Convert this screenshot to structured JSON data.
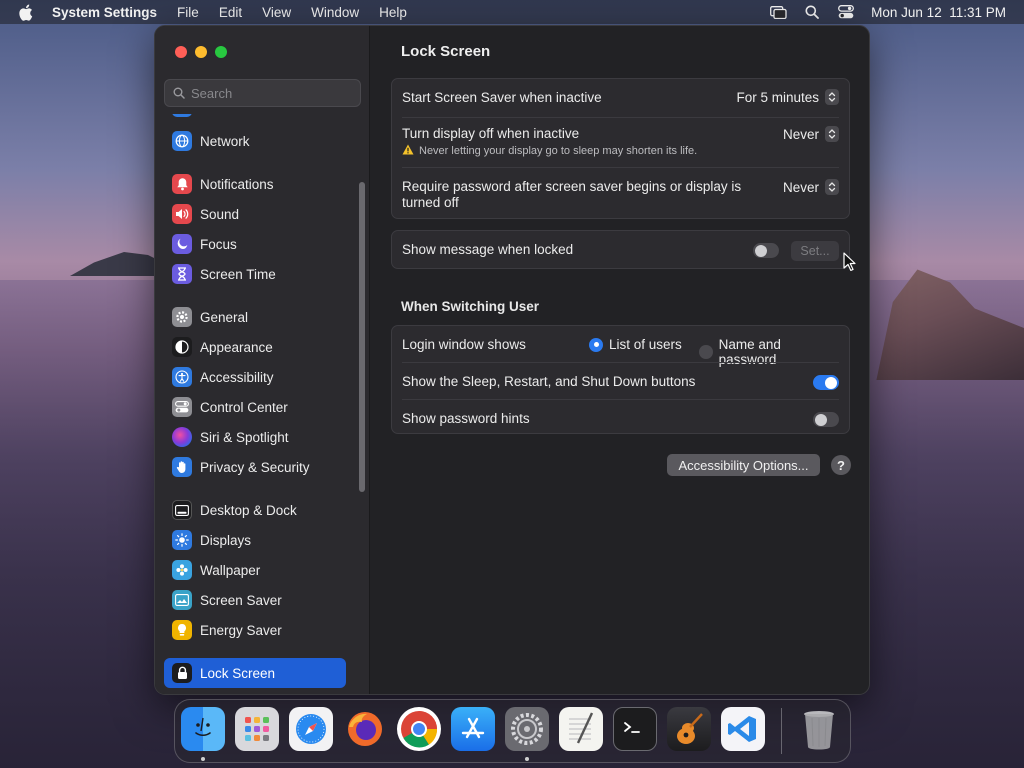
{
  "menubar": {
    "app_name": "System Settings",
    "menus": [
      "File",
      "Edit",
      "View",
      "Window",
      "Help"
    ],
    "clock": "Mon Jun 12  11:31 PM",
    "icons": [
      "screen-mirroring-icon",
      "spotlight-search-icon",
      "control-center-icon"
    ]
  },
  "search": {
    "placeholder": "Search"
  },
  "sidebar": {
    "items": [
      {
        "label": "Network",
        "icon": "globe-icon",
        "color": "#2f7ae0"
      },
      {
        "label": "Notifications",
        "icon": "bell-icon",
        "color": "#e5484d"
      },
      {
        "label": "Sound",
        "icon": "speaker-icon",
        "color": "#e5484d"
      },
      {
        "label": "Focus",
        "icon": "moon-icon",
        "color": "#6b5ce0"
      },
      {
        "label": "Screen Time",
        "icon": "hourglass-icon",
        "color": "#6b5ce0"
      },
      {
        "label": "General",
        "icon": "gear-icon",
        "color": "#8e8e93"
      },
      {
        "label": "Appearance",
        "icon": "appearance-icon",
        "color": "#1c1c1e"
      },
      {
        "label": "Accessibility",
        "icon": "accessibility-icon",
        "color": "#2f7ae0"
      },
      {
        "label": "Control Center",
        "icon": "control-center-icon",
        "color": "#8e8e93"
      },
      {
        "label": "Siri & Spotlight",
        "icon": "siri-icon",
        "color": "#a04ad8"
      },
      {
        "label": "Privacy & Security",
        "icon": "hand-icon",
        "color": "#2f7ae0"
      },
      {
        "label": "Desktop & Dock",
        "icon": "dock-icon",
        "color": "#1c1c1e"
      },
      {
        "label": "Displays",
        "icon": "sun-icon",
        "color": "#2f7ae0"
      },
      {
        "label": "Wallpaper",
        "icon": "wallpaper-icon",
        "color": "#3aa3e0"
      },
      {
        "label": "Screen Saver",
        "icon": "screen-saver-icon",
        "color": "#3aa3c8"
      },
      {
        "label": "Energy Saver",
        "icon": "bulb-icon",
        "color": "#f0b400"
      },
      {
        "label": "Lock Screen",
        "icon": "lock-icon",
        "color": "#1c1c1e",
        "selected": true
      }
    ]
  },
  "content": {
    "title": "Lock Screen",
    "screen_saver": {
      "label": "Start Screen Saver when inactive",
      "value": "For 5 minutes"
    },
    "display_off": {
      "label": "Turn display off when inactive",
      "value": "Never",
      "warning": "Never letting your display go to sleep may shorten its life."
    },
    "require_password": {
      "label_line1": "Require password after screen saver begins or display is",
      "label_line2": "turned off",
      "value": "Never"
    },
    "show_message": {
      "label": "Show message when locked",
      "enabled": false,
      "button": "Set..."
    },
    "switching_title": "When Switching User",
    "login_window": {
      "label": "Login window shows",
      "option1": "List of users",
      "option2": "Name and password",
      "selected": "List of users"
    },
    "sleep_buttons": {
      "label": "Show the Sleep, Restart, and Shut Down buttons",
      "enabled": true
    },
    "password_hints": {
      "label": "Show password hints",
      "enabled": false
    },
    "accessibility_button": "Accessibility Options...",
    "help_button": "?"
  },
  "dock": {
    "apps": [
      "finder-icon",
      "launchpad-icon",
      "safari-icon",
      "firefox-icon",
      "chrome-icon",
      "app-store-icon",
      "system-settings-icon",
      "textedit-icon",
      "terminal-icon",
      "garageband-icon",
      "vscode-icon",
      "trash-icon"
    ]
  }
}
